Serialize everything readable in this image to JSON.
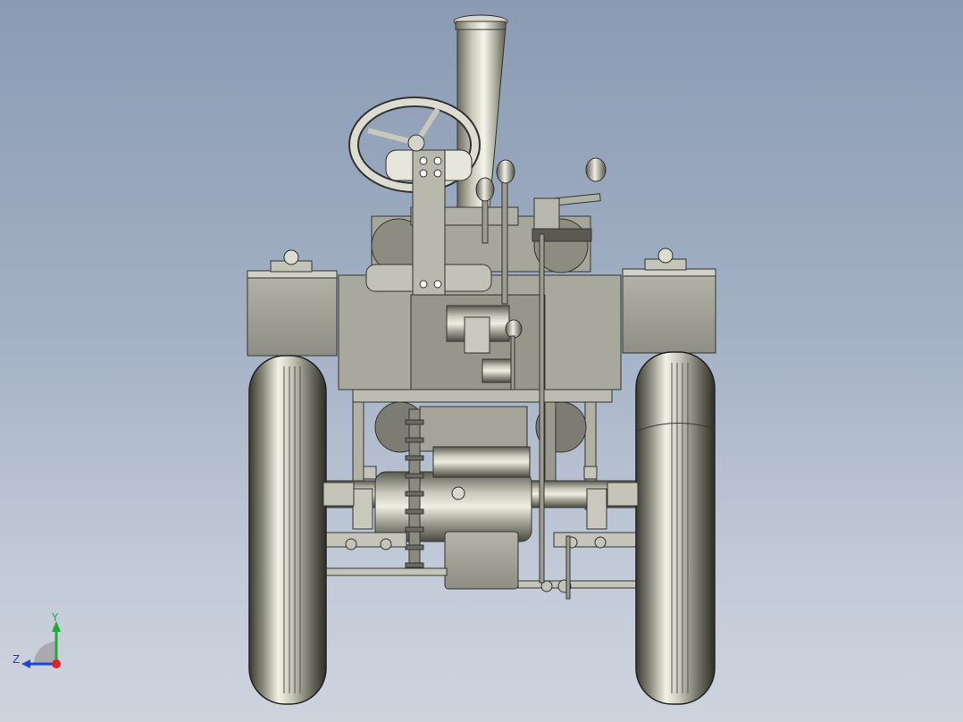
{
  "viewport": {
    "background_top": "#8a9bb4",
    "background_bottom": "#ced4de",
    "model": "steam-traction-engine-front-view"
  },
  "triad": {
    "x_color": "#e0202a",
    "y_color": "#22aa33",
    "z_color": "#2244dd",
    "y_label": "Y",
    "z_label": "Z"
  }
}
